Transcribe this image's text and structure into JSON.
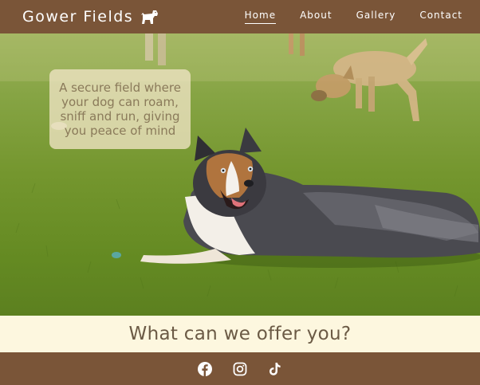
{
  "header": {
    "brand": "Gower Fields",
    "brand_icon": "dog-icon",
    "nav": [
      {
        "label": "Home",
        "active": true
      },
      {
        "label": "About",
        "active": false
      },
      {
        "label": "Gallery",
        "active": false
      },
      {
        "label": "Contact",
        "active": false
      }
    ]
  },
  "hero": {
    "tagline": "A secure field where your dog can roam, sniff and run, giving you peace of mind"
  },
  "offer": {
    "heading": "What can we offer you?"
  },
  "footer": {
    "social": [
      "facebook-icon",
      "instagram-icon",
      "tiktok-icon"
    ]
  },
  "colors": {
    "header_bg": "#7a5538",
    "footer_bg": "#7a5538",
    "offer_bg": "#fdf7df",
    "heading_text": "#6b5a45"
  }
}
